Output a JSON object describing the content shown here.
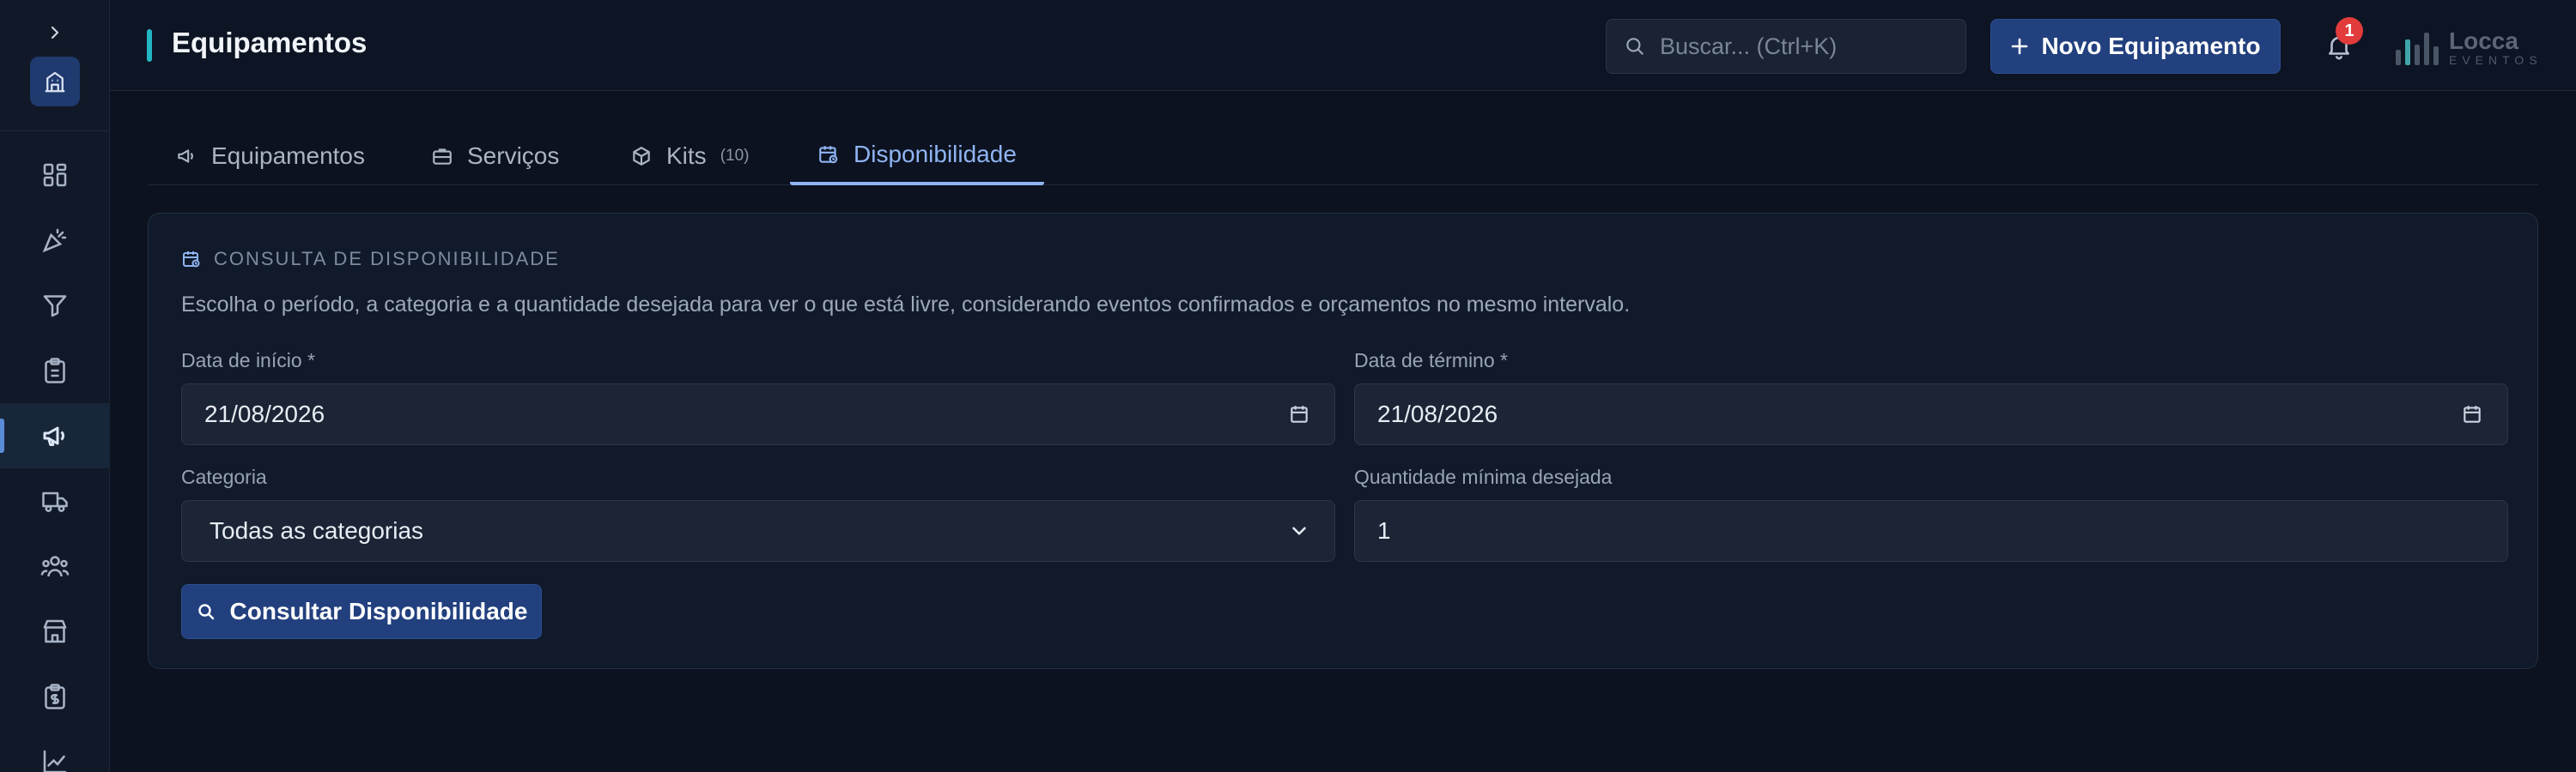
{
  "header": {
    "title": "Equipamentos",
    "search_placeholder": "Buscar... (Ctrl+K)",
    "new_button": "Novo Equipamento",
    "notification_count": "1",
    "brand_name": "Locca",
    "brand_sub": "EVENTOS"
  },
  "sidebar": {
    "items": [
      {
        "icon": "dashboard-icon"
      },
      {
        "icon": "party-icon"
      },
      {
        "icon": "filter-icon"
      },
      {
        "icon": "clipboard-icon"
      },
      {
        "icon": "megaphone-icon",
        "active": true
      },
      {
        "icon": "truck-icon"
      },
      {
        "icon": "users-icon"
      },
      {
        "icon": "store-icon"
      },
      {
        "icon": "invoice-icon"
      },
      {
        "icon": "chart-icon"
      }
    ]
  },
  "tabs": [
    {
      "label": "Equipamentos",
      "count": ""
    },
    {
      "label": "Serviços",
      "count": ""
    },
    {
      "label": "Kits",
      "count": "(10)"
    },
    {
      "label": "Disponibilidade",
      "count": "",
      "active": true
    }
  ],
  "card": {
    "title": "CONSULTA DE DISPONIBILIDADE",
    "description": "Escolha o período, a categoria e a quantidade desejada para ver o que está livre, considerando eventos confirmados e orçamentos no mesmo intervalo.",
    "start_label": "Data de início *",
    "start_value": "21/08/2026",
    "end_label": "Data de término *",
    "end_value": "21/08/2026",
    "category_label": "Categoria",
    "category_value": "Todas as categorias",
    "quantity_label": "Quantidade mínima desejada",
    "quantity_value": "1",
    "submit": "Consultar Disponibilidade"
  },
  "colors": {
    "accent": "#22407e",
    "tab_active": "#8fb4f2",
    "title_accent": "#22b5c4",
    "badge": "#e23b3b"
  }
}
